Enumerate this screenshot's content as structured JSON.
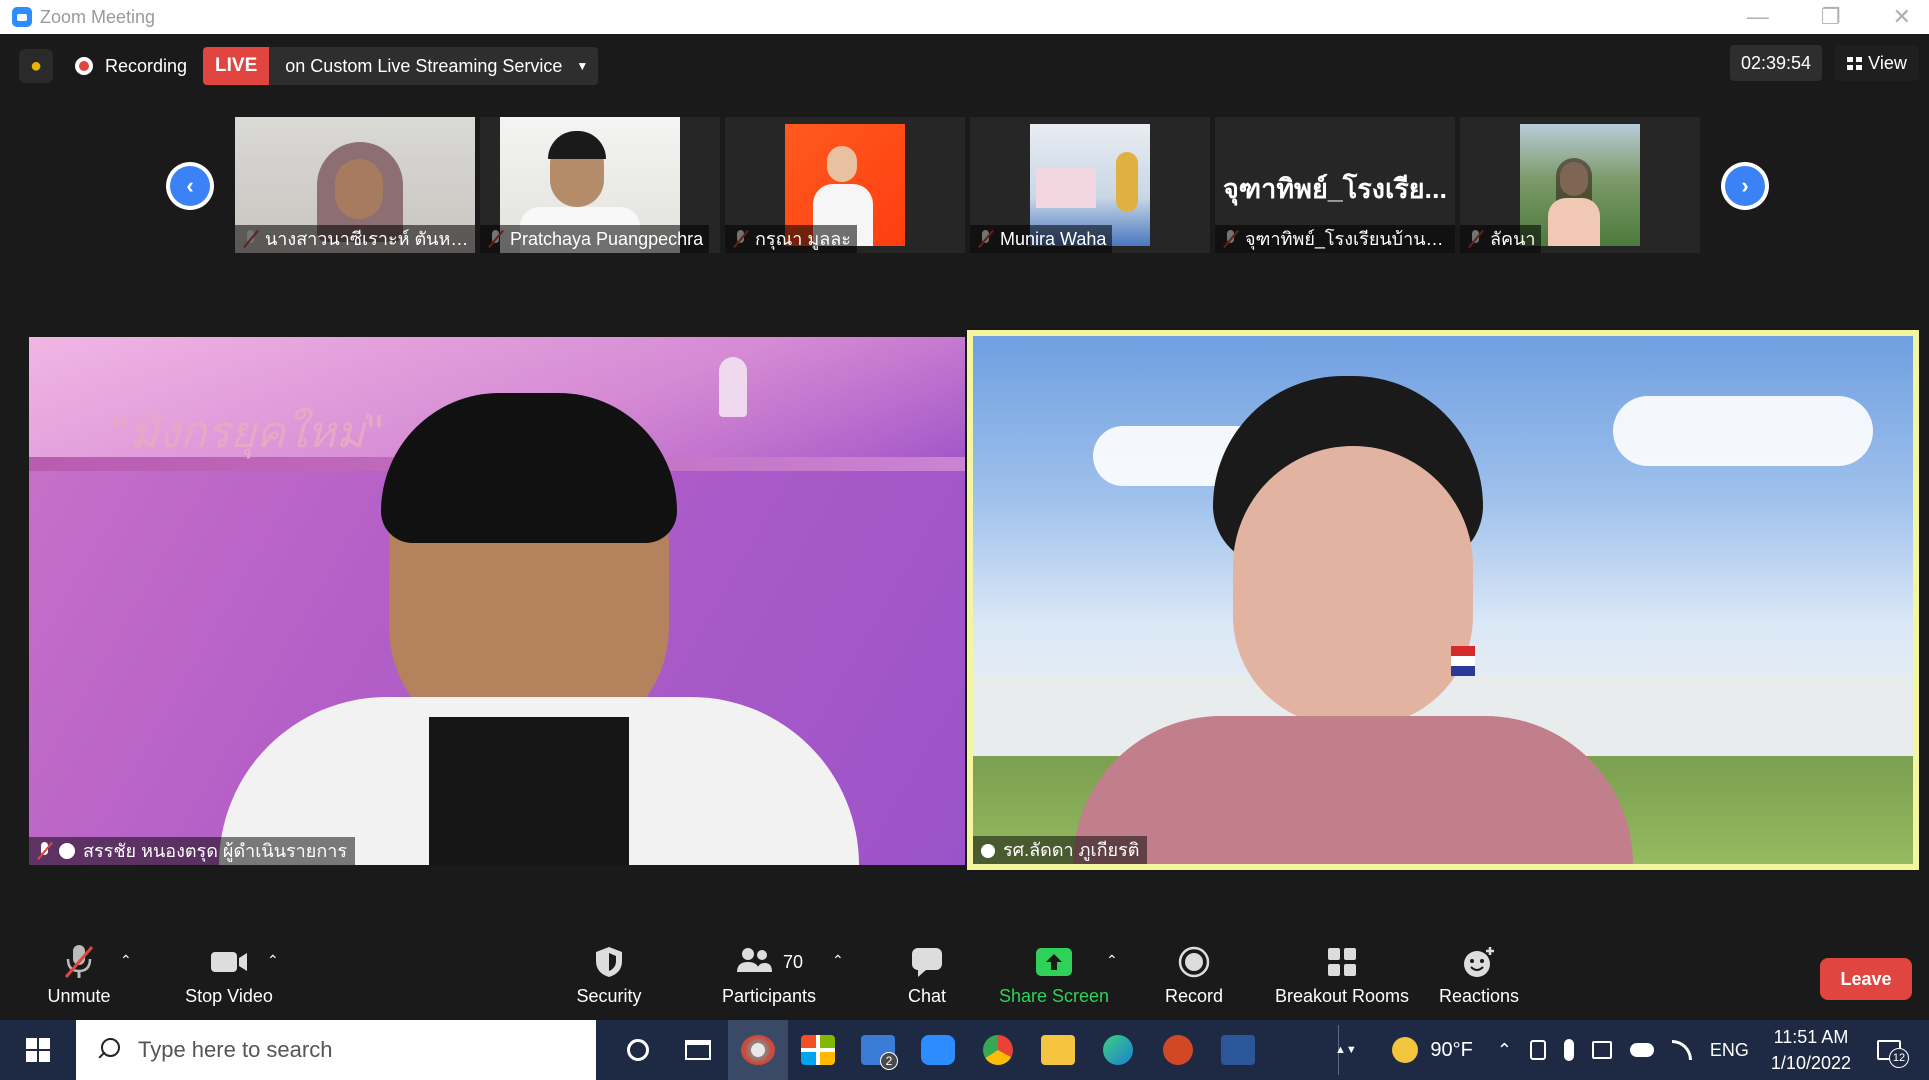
{
  "window": {
    "title": "Zoom Meeting"
  },
  "topbar": {
    "recording_label": "Recording",
    "live_badge": "LIVE",
    "live_text": "on Custom Live Streaming Service",
    "timer": "02:39:54",
    "view_label": "View"
  },
  "strip": {
    "tiles": [
      {
        "name": "นางสาวนาซีเราะห์ ตันหยง..."
      },
      {
        "name": "Pratchaya Puangpechra"
      },
      {
        "name": "กรุณา มูลละ"
      },
      {
        "name": "Munira Waha"
      },
      {
        "name": "จุฑาทิพย์_โรงเรียนบ้านพรุ...",
        "display_name": "จุฑาทิพย์_โรงเรีย..."
      },
      {
        "name": "ลัคนา"
      }
    ]
  },
  "main": {
    "left": {
      "name": "สรรชัย หนองตรุด ผู้ดำเนินรายการ",
      "slide_title": "\"มังกรยุคใหม่\""
    },
    "right": {
      "name": "รศ.ลัดดา ภูเกียรติ"
    }
  },
  "toolbar": {
    "unmute": "Unmute",
    "stop_video": "Stop Video",
    "security": "Security",
    "participants": "Participants",
    "participants_count": "70",
    "chat": "Chat",
    "share_screen": "Share Screen",
    "record": "Record",
    "breakout_rooms": "Breakout Rooms",
    "reactions": "Reactions",
    "leave": "Leave"
  },
  "taskbar": {
    "search_placeholder": "Type here to search",
    "mail_badge": "2",
    "weather": "90°F",
    "language": "ENG",
    "time": "11:51 AM",
    "date": "1/10/2022",
    "notifications": "12"
  },
  "colors": {
    "accent_blue": "#2d8cff",
    "live_red": "#e0463f",
    "share_green": "#2fd159",
    "active_border": "#f3f5a0"
  }
}
